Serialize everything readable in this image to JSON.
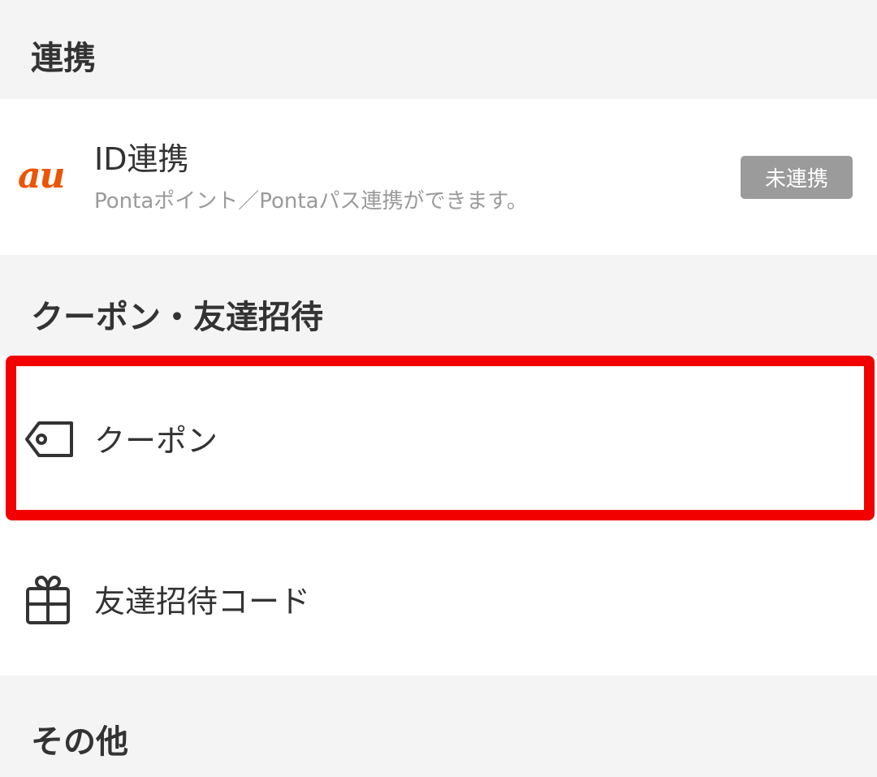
{
  "sections": {
    "link": {
      "title": "連携"
    },
    "coupon_invite": {
      "title": "クーポン・友達招待"
    },
    "other": {
      "title": "その他"
    }
  },
  "id_link": {
    "logo_text": "au",
    "logo_color": "#eb5505",
    "title": "ID連携",
    "subtitle": "Pontaポイント／Pontaパス連携ができます。",
    "status": "未連携"
  },
  "menu": {
    "coupon": {
      "label": "クーポン",
      "icon": "tag-icon"
    },
    "invite": {
      "label": "友達招待コード",
      "icon": "gift-icon"
    }
  },
  "colors": {
    "background": "#f4f4f4",
    "row_background": "#ffffff",
    "text": "#333333",
    "subtext": "#9a9a9a",
    "badge": "#9b9b9b",
    "highlight": "#f20000"
  }
}
